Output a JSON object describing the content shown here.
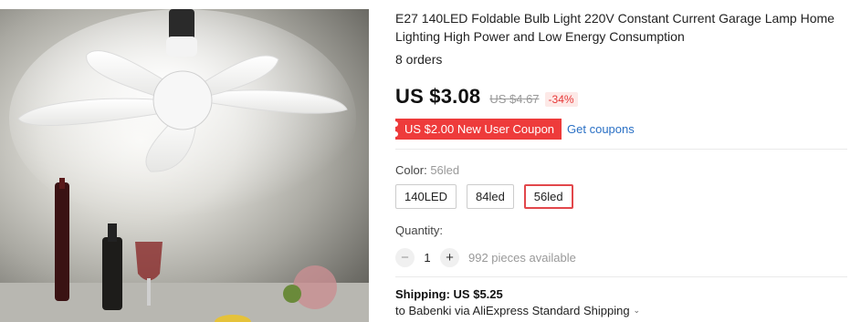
{
  "product": {
    "title": "E27 140LED Foldable Bulb Light 220V Constant Current Garage Lamp Home Lighting High Power and Low Energy Consumption",
    "orders": "8 orders",
    "image_alt": "foldable-fan-bulb-photo"
  },
  "pricing": {
    "price": "US $3.08",
    "original_price": "US $4.67",
    "discount": "-34%"
  },
  "coupon": {
    "label": "US $2.00 New User Coupon",
    "link": "Get coupons"
  },
  "color": {
    "label": "Color:",
    "selected": "56led",
    "options": [
      "140LED",
      "84led",
      "56led"
    ]
  },
  "quantity": {
    "label": "Quantity:",
    "minus": "−",
    "value": "1",
    "plus": "+",
    "available": "992 pieces available"
  },
  "shipping": {
    "cost": "Shipping: US $5.25",
    "via": "to Babenki via AliExpress Standard Shipping",
    "chevron": "⌄"
  },
  "colors": {
    "price_red": "#ee3b3b",
    "link_blue": "#2a70c5",
    "selected_border": "#e2474b"
  }
}
